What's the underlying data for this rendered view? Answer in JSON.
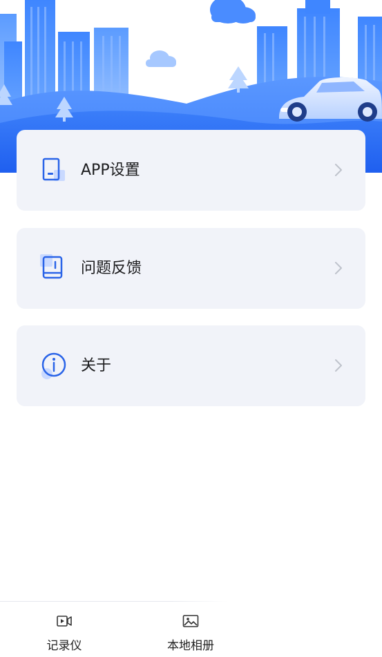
{
  "menu": {
    "items": [
      {
        "label": "APP设置",
        "icon": "tablet-settings-icon"
      },
      {
        "label": "问题反馈",
        "icon": "feedback-book-icon"
      },
      {
        "label": "关于",
        "icon": "info-icon"
      }
    ]
  },
  "tabbar": {
    "tabs": [
      {
        "label": "记录仪",
        "icon": "video-recorder-icon"
      },
      {
        "label": "本地相册",
        "icon": "image-gallery-icon"
      }
    ]
  },
  "colors": {
    "accent": "#2f6ff5",
    "card_bg": "#f1f3f9",
    "icon_blue": "#2a64e8",
    "chevron": "#bfc3cc"
  }
}
